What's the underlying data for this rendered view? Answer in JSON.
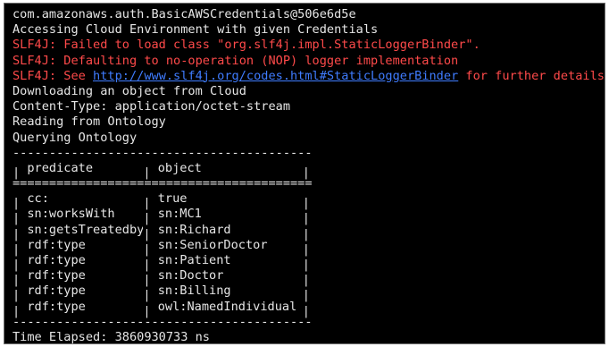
{
  "terminal": {
    "lines": [
      "com.amazonaws.auth.BasicAWSCredentials@506e6d5e",
      "Accessing Cloud Environment with given Credentials"
    ],
    "errors": [
      "SLF4J: Failed to load class \"org.slf4j.impl.StaticLoggerBinder\".",
      "SLF4J: Defaulting to no-operation (NOP) logger implementation"
    ],
    "see_line": {
      "prefix": "SLF4J: See ",
      "link": "http://www.slf4j.org/codes.html#StaticLoggerBinder",
      "suffix": " for further details."
    },
    "status_lines": [
      "Downloading an object from Cloud",
      "Content-Type: application/octet-stream",
      "Reading from Ontology",
      "Querying Ontology"
    ],
    "table": {
      "rule_top": "-----------------------------------------",
      "header": [
        "predicate",
        "object"
      ],
      "rule_header": "=========================================",
      "rows": [
        [
          "cc:",
          "true"
        ],
        [
          "sn:worksWith",
          "sn:MC1"
        ],
        [
          "sn:getsTreatedby",
          "sn:Richard"
        ],
        [
          "rdf:type",
          "sn:SeniorDoctor"
        ],
        [
          "rdf:type",
          "sn:Patient"
        ],
        [
          "rdf:type",
          "sn:Doctor"
        ],
        [
          "rdf:type",
          "sn:Billing"
        ],
        [
          "rdf:type",
          "owl:NamedIndividual"
        ]
      ],
      "rule_bottom": "-----------------------------------------"
    },
    "footer": "Time Elapsed: 3860930733 ns",
    "colors": {
      "background": "#000000",
      "text": "#e6e6e6",
      "error": "#ff4a4a",
      "link": "#3f7cff"
    }
  }
}
